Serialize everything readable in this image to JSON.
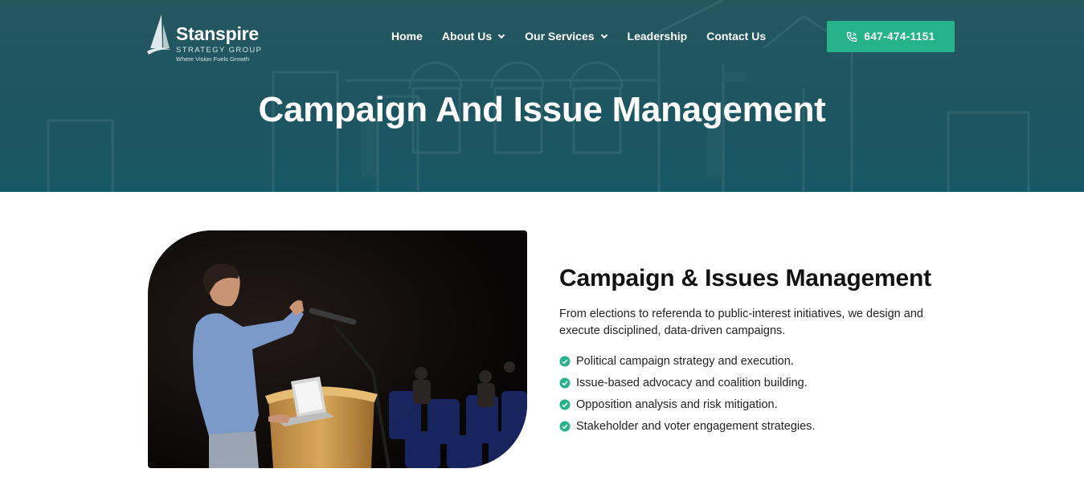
{
  "brand": {
    "name": "Stanspire",
    "subtitle": "STRATEGY GROUP",
    "tagline": "Where Vision Fuels Growth"
  },
  "nav": {
    "items": [
      {
        "label": "Home"
      },
      {
        "label": "About Us"
      },
      {
        "label": "Our Services"
      },
      {
        "label": "Leadership"
      },
      {
        "label": "Contact Us"
      }
    ],
    "phone": "647-474-1151"
  },
  "hero": {
    "title": "Campaign And Issue Management"
  },
  "content": {
    "title": "Campaign & Issues Management",
    "description": "From elections to referenda to public-interest initiatives, we design and execute disciplined, data-driven campaigns.",
    "bullets": [
      "Political campaign strategy and execution.",
      "Issue-based advocacy and coalition building.",
      "Opposition analysis and risk mitigation.",
      "Stakeholder and voter engagement strategies."
    ]
  },
  "colors": {
    "hero_bg": "#1d5560",
    "accent": "#26b38b",
    "check": "#26b38b",
    "text": "#222222"
  },
  "icons": {
    "phone": "phone-icon",
    "dropdown": "chevron-down-icon",
    "bullet": "check-circle-icon"
  }
}
